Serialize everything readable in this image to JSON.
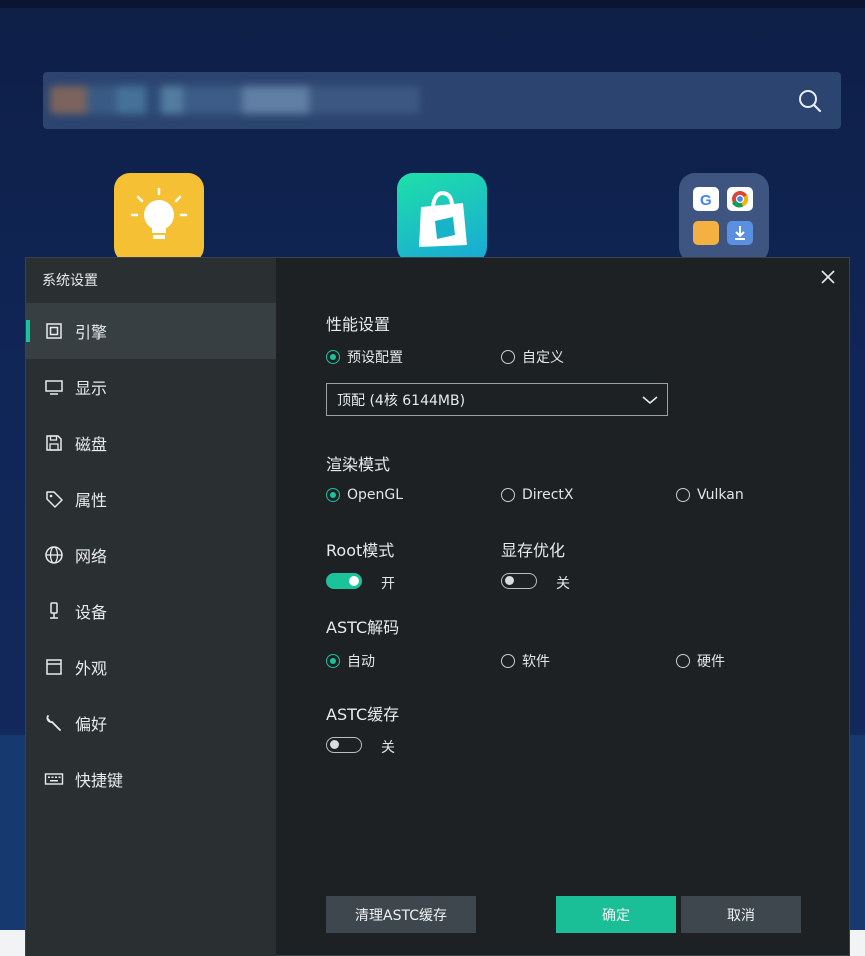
{
  "dialog": {
    "title": "系统设置"
  },
  "sidebar": {
    "items": [
      {
        "label": "引擎"
      },
      {
        "label": "显示"
      },
      {
        "label": "磁盘"
      },
      {
        "label": "属性"
      },
      {
        "label": "网络"
      },
      {
        "label": "设备"
      },
      {
        "label": "外观"
      },
      {
        "label": "偏好"
      },
      {
        "label": "快捷键"
      }
    ],
    "active_index": 0
  },
  "performance": {
    "title": "性能设置",
    "options": [
      "预设配置",
      "自定义"
    ],
    "selected": "预设配置",
    "preset_value": "顶配 (4核 6144MB)"
  },
  "render": {
    "title": "渲染模式",
    "options": [
      "OpenGL",
      "DirectX",
      "Vulkan"
    ],
    "selected": "OpenGL"
  },
  "root": {
    "title": "Root模式",
    "state_label": "开",
    "enabled": true
  },
  "memory": {
    "title": "显存优化",
    "state_label": "关",
    "enabled": false
  },
  "astc_decode": {
    "title": "ASTC解码",
    "options": [
      "自动",
      "软件",
      "硬件"
    ],
    "selected": "自动"
  },
  "astc_cache": {
    "title": "ASTC缓存",
    "state_label": "关",
    "enabled": false
  },
  "buttons": {
    "clear": "清理ASTC缓存",
    "ok": "确定",
    "cancel": "取消"
  },
  "colors": {
    "accent": "#1bc39a",
    "dialog_bg": "#1d2123",
    "sidebar_bg": "#2a2f32"
  }
}
